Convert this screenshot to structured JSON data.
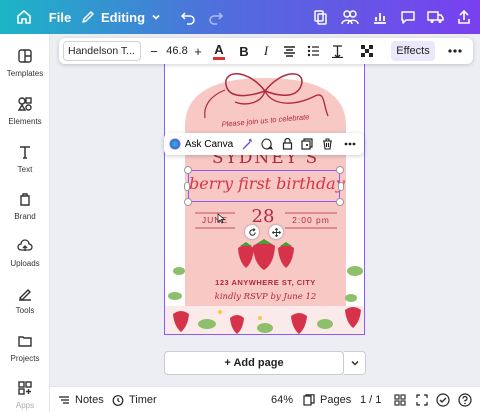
{
  "topbar": {
    "file_label": "File",
    "editing_label": "Editing",
    "icons": [
      "home-icon",
      "pencil-icon",
      "chevron-down-icon",
      "undo-icon",
      "redo-icon",
      "resize-icon",
      "people-icon",
      "analytics-icon",
      "comment-icon",
      "truck-icon",
      "share-icon"
    ]
  },
  "rail": {
    "items": [
      {
        "label": "Templates",
        "icon": "templates-icon"
      },
      {
        "label": "Elements",
        "icon": "elements-icon"
      },
      {
        "label": "Text",
        "icon": "text-icon"
      },
      {
        "label": "Brand",
        "icon": "brand-icon"
      },
      {
        "label": "Uploads",
        "icon": "uploads-icon"
      },
      {
        "label": "Tools",
        "icon": "tools-icon"
      },
      {
        "label": "Projects",
        "icon": "projects-icon"
      },
      {
        "label": "Apps",
        "icon": "apps-icon"
      }
    ]
  },
  "text_toolbar": {
    "font_name": "Handelson T...",
    "font_size": "46.8",
    "minus": "−",
    "plus": "+",
    "text_color": "#e03131",
    "effects_label": "Effects"
  },
  "float_toolbar": {
    "ask_label": "Ask Canva"
  },
  "design": {
    "top_line": "Please join us to celebrate",
    "name_text": "SYDNEY'S",
    "headline": "berry first birthday",
    "month": "JUNE",
    "day": "28",
    "time": "2:00 pm",
    "address": "123 ANYWHERE ST, CITY",
    "rsvp": "kindly RSVP by June 12"
  },
  "add_page_label": "+ Add page",
  "bottombar": {
    "notes_label": "Notes",
    "timer_label": "Timer",
    "zoom": "64%",
    "pages_label": "Pages",
    "page_count": "1 / 1"
  },
  "colors": {
    "accent": "#8a5cf5",
    "pink_panel": "#f7c8c4",
    "berry_red": "#d6334a",
    "text_dark_red": "#b2283e"
  }
}
